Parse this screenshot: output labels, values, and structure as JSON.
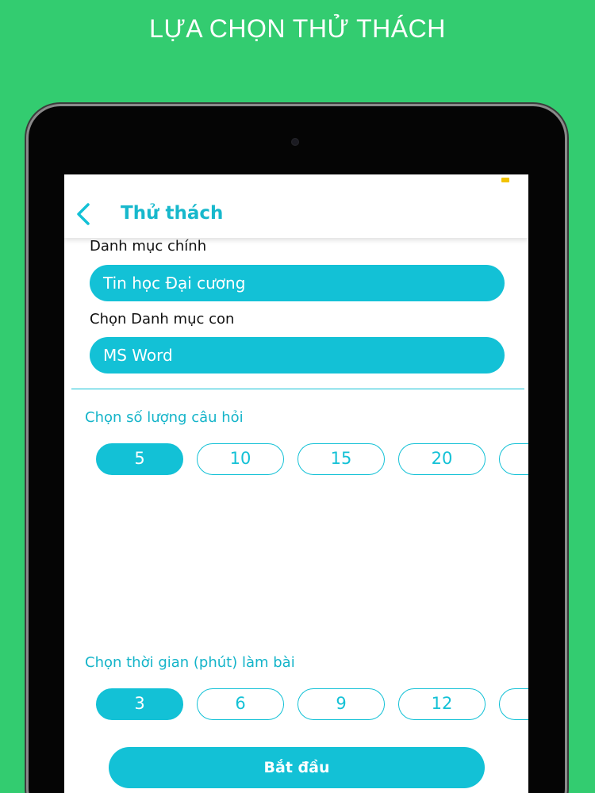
{
  "promo": {
    "title": "LỰA CHỌN THỬ THÁCH"
  },
  "navbar": {
    "back_icon": "chevron-left-icon",
    "title": "Thử thách"
  },
  "main_category": {
    "label": "Danh mục chính",
    "value": "Tin học Đại cương"
  },
  "sub_category": {
    "label": "Chọn Danh mục con",
    "value": "MS Word"
  },
  "question_count": {
    "label": "Chọn số lượng câu hỏi",
    "options": [
      "5",
      "10",
      "15",
      "20",
      ""
    ],
    "selected": "5"
  },
  "time_limit": {
    "label": "Chọn thời gian (phút) làm bài",
    "options": [
      "3",
      "6",
      "9",
      "12",
      ""
    ],
    "selected": "3"
  },
  "start_button": {
    "label": "Bắt đầu"
  },
  "colors": {
    "background": "#33cc70",
    "accent": "#13c1d6",
    "title_text": "#17b8cc"
  }
}
